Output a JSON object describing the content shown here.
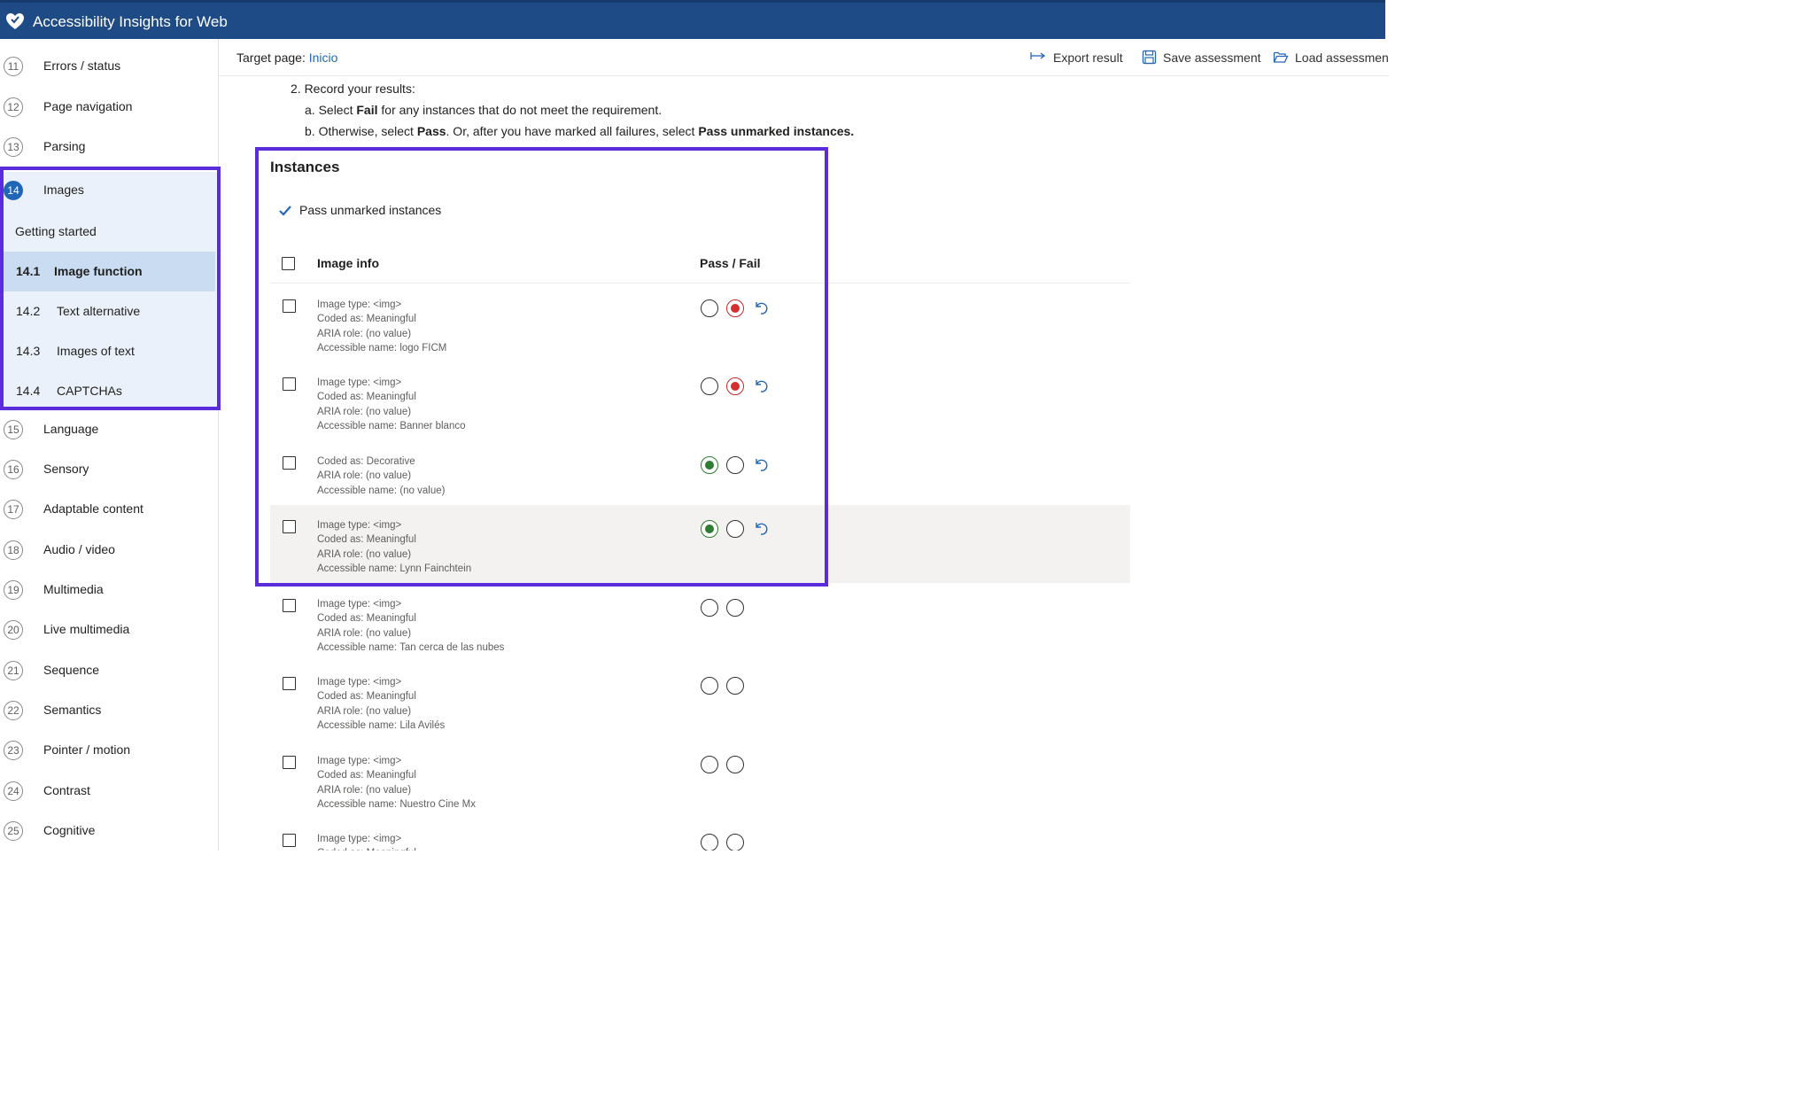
{
  "app": {
    "title": "Accessibility Insights for Web"
  },
  "command_bar": {
    "target_label": "Target page:",
    "target_link": "Inicio",
    "export": "Export result",
    "save": "Save assessment",
    "load": "Load assessmen"
  },
  "nav": {
    "items_before": [
      {
        "num": "11",
        "label": "Errors / status"
      },
      {
        "num": "12",
        "label": "Page navigation"
      },
      {
        "num": "13",
        "label": "Parsing"
      }
    ],
    "group": {
      "num": "14",
      "label": "Images",
      "getting_started": "Getting started",
      "subs": [
        {
          "num": "14.1",
          "label": "Image function",
          "selected": true
        },
        {
          "num": "14.2",
          "label": "Text alternative"
        },
        {
          "num": "14.3",
          "label": "Images of text"
        },
        {
          "num": "14.4",
          "label": "CAPTCHAs"
        }
      ]
    },
    "items_after": [
      {
        "num": "15",
        "label": "Language"
      },
      {
        "num": "16",
        "label": "Sensory"
      },
      {
        "num": "17",
        "label": "Adaptable content"
      },
      {
        "num": "18",
        "label": "Audio / video"
      },
      {
        "num": "19",
        "label": "Multimedia"
      },
      {
        "num": "20",
        "label": "Live multimedia"
      },
      {
        "num": "21",
        "label": "Sequence"
      },
      {
        "num": "22",
        "label": "Semantics"
      },
      {
        "num": "23",
        "label": "Pointer / motion"
      },
      {
        "num": "24",
        "label": "Contrast"
      },
      {
        "num": "25",
        "label": "Cognitive"
      }
    ]
  },
  "instructions": {
    "step": "2. Record your results:",
    "a_pre": "a. Select ",
    "a_bold": "Fail",
    "a_post": " for any instances that do not meet the requirement.",
    "b_pre": "b. Otherwise, select ",
    "b_bold1": "Pass",
    "b_mid": ". Or, after you have marked all failures, select ",
    "b_bold2": "Pass unmarked instances."
  },
  "instances": {
    "title": "Instances",
    "pass_unmarked": "Pass unmarked instances",
    "col_image_info": "Image info",
    "col_pass_fail": "Pass / Fail",
    "rows": [
      {
        "lines": [
          "Image type: <img>",
          "Coded as: Meaningful",
          "ARIA role: (no value)",
          "Accessible name: logo FICM"
        ],
        "status": "fail"
      },
      {
        "lines": [
          "Image type: <img>",
          "Coded as: Meaningful",
          "ARIA role: (no value)",
          "Accessible name: Banner blanco"
        ],
        "status": "fail"
      },
      {
        "lines": [
          "Coded as: Decorative",
          "ARIA role: (no value)",
          "Accessible name: (no value)"
        ],
        "status": "pass"
      },
      {
        "lines": [
          "Image type: <img>",
          "Coded as: Meaningful",
          "ARIA role: (no value)",
          "Accessible name: Lynn Fainchtein"
        ],
        "status": "pass",
        "hover": true
      },
      {
        "lines": [
          "Image type: <img>",
          "Coded as: Meaningful",
          "ARIA role: (no value)",
          "Accessible name: Tan cerca de las nubes"
        ],
        "status": "none"
      },
      {
        "lines": [
          "Image type: <img>",
          "Coded as: Meaningful",
          "ARIA role: (no value)",
          "Accessible name: Lila Avilés"
        ],
        "status": "none"
      },
      {
        "lines": [
          "Image type: <img>",
          "Coded as: Meaningful",
          "ARIA role: (no value)",
          "Accessible name: Nuestro Cine Mx"
        ],
        "status": "none"
      },
      {
        "lines": [
          "Image type: <img>",
          "Coded as: Meaningful"
        ],
        "status": "none"
      }
    ]
  },
  "colors": {
    "header": "#1e4a86",
    "highlight": "#5a2cdb",
    "fail": "#d32f2f",
    "pass": "#2e7d32",
    "link": "#2566b8"
  },
  "icons": {
    "logo": "heart-shield-icon",
    "export": "export-arrow-icon",
    "save": "floppy-disk-icon",
    "load": "folder-open-icon",
    "check": "checkmark-icon",
    "undo": "undo-icon"
  }
}
